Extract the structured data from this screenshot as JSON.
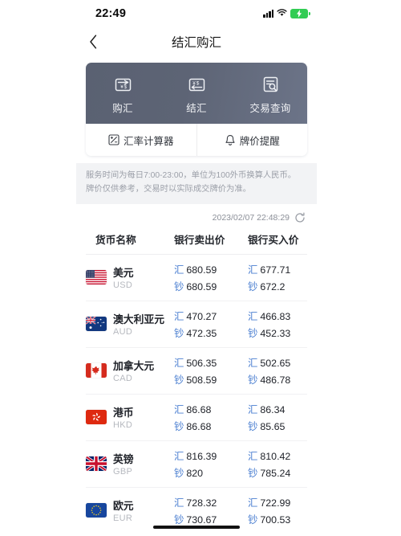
{
  "status_bar": {
    "time": "22:49",
    "signal_icon": "signal-bars-icon",
    "wifi_icon": "wifi-icon",
    "battery_icon": "battery-charging-icon"
  },
  "nav": {
    "back_icon": "chevron-left-icon",
    "title": "结汇购汇"
  },
  "quick_actions": [
    {
      "label": "购汇",
      "icon": "buy-forex-icon"
    },
    {
      "label": "结汇",
      "icon": "settle-forex-icon"
    },
    {
      "label": "交易查询",
      "icon": "transaction-search-icon"
    }
  ],
  "tools": [
    {
      "label": "汇率计算器",
      "icon": "calculator-icon"
    },
    {
      "label": "牌价提醒",
      "icon": "bell-icon"
    }
  ],
  "notice": {
    "line1": "服务时间为每日7:00-23:00，单位为100外币换算人民币。",
    "line2": "牌价仅供参考，交易时以实际成交牌价为准。"
  },
  "timestamp": {
    "value": "2023/02/07 22:48:29",
    "refresh_icon": "refresh-icon"
  },
  "table": {
    "headers": [
      "货币名称",
      "银行卖出价",
      "银行买入价"
    ],
    "labels": {
      "wire": "汇",
      "cash": "钞"
    },
    "accent_color": "#4b7fd1",
    "rows": [
      {
        "name_zh": "美元",
        "code": "USD",
        "flag": "flag-us",
        "sell_wire": "680.59",
        "sell_cash": "680.59",
        "buy_wire": "677.71",
        "buy_cash": "672.2"
      },
      {
        "name_zh": "澳大利亚元",
        "code": "AUD",
        "flag": "flag-au",
        "sell_wire": "470.27",
        "sell_cash": "472.35",
        "buy_wire": "466.83",
        "buy_cash": "452.33"
      },
      {
        "name_zh": "加拿大元",
        "code": "CAD",
        "flag": "flag-ca",
        "sell_wire": "506.35",
        "sell_cash": "508.59",
        "buy_wire": "502.65",
        "buy_cash": "486.78"
      },
      {
        "name_zh": "港币",
        "code": "HKD",
        "flag": "flag-hk",
        "sell_wire": "86.68",
        "sell_cash": "86.68",
        "buy_wire": "86.34",
        "buy_cash": "85.65"
      },
      {
        "name_zh": "英镑",
        "code": "GBP",
        "flag": "flag-gb",
        "sell_wire": "816.39",
        "sell_cash": "820",
        "buy_wire": "810.42",
        "buy_cash": "785.24"
      },
      {
        "name_zh": "欧元",
        "code": "EUR",
        "flag": "flag-eu",
        "sell_wire": "728.32",
        "sell_cash": "730.67",
        "buy_wire": "722.99",
        "buy_cash": "700.53"
      }
    ]
  },
  "home_indicator": "home-indicator"
}
